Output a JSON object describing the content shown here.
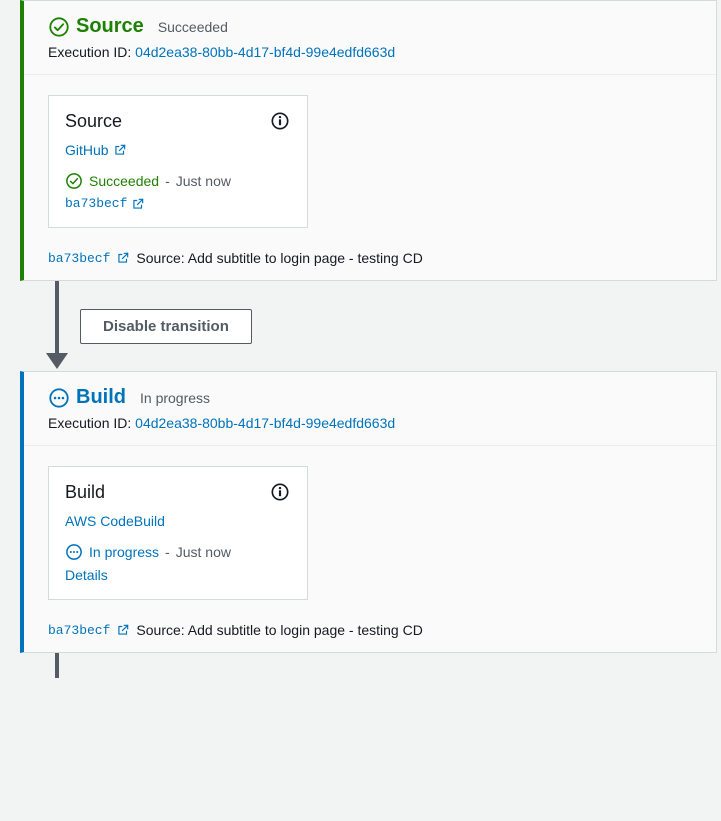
{
  "execution_id": "04d2ea38-80bb-4d17-bf4d-99e4edfd663d",
  "execution_id_label": "Execution ID:",
  "stages": {
    "source": {
      "name": "Source",
      "status": "Succeeded",
      "action": {
        "name": "Source",
        "provider": "GitHub",
        "status": "Succeeded",
        "time": "Just now",
        "commit": "ba73becf"
      },
      "summary": {
        "commit": "ba73becf",
        "message": "Source: Add subtitle to login page - testing CD"
      }
    },
    "build": {
      "name": "Build",
      "status": "In progress",
      "action": {
        "name": "Build",
        "provider": "AWS CodeBuild",
        "status": "In progress",
        "time": "Just now",
        "details": "Details"
      },
      "summary": {
        "commit": "ba73becf",
        "message": "Source: Add subtitle to login page - testing CD"
      }
    }
  },
  "transition": {
    "disable_label": "Disable transition"
  },
  "separator": "-"
}
